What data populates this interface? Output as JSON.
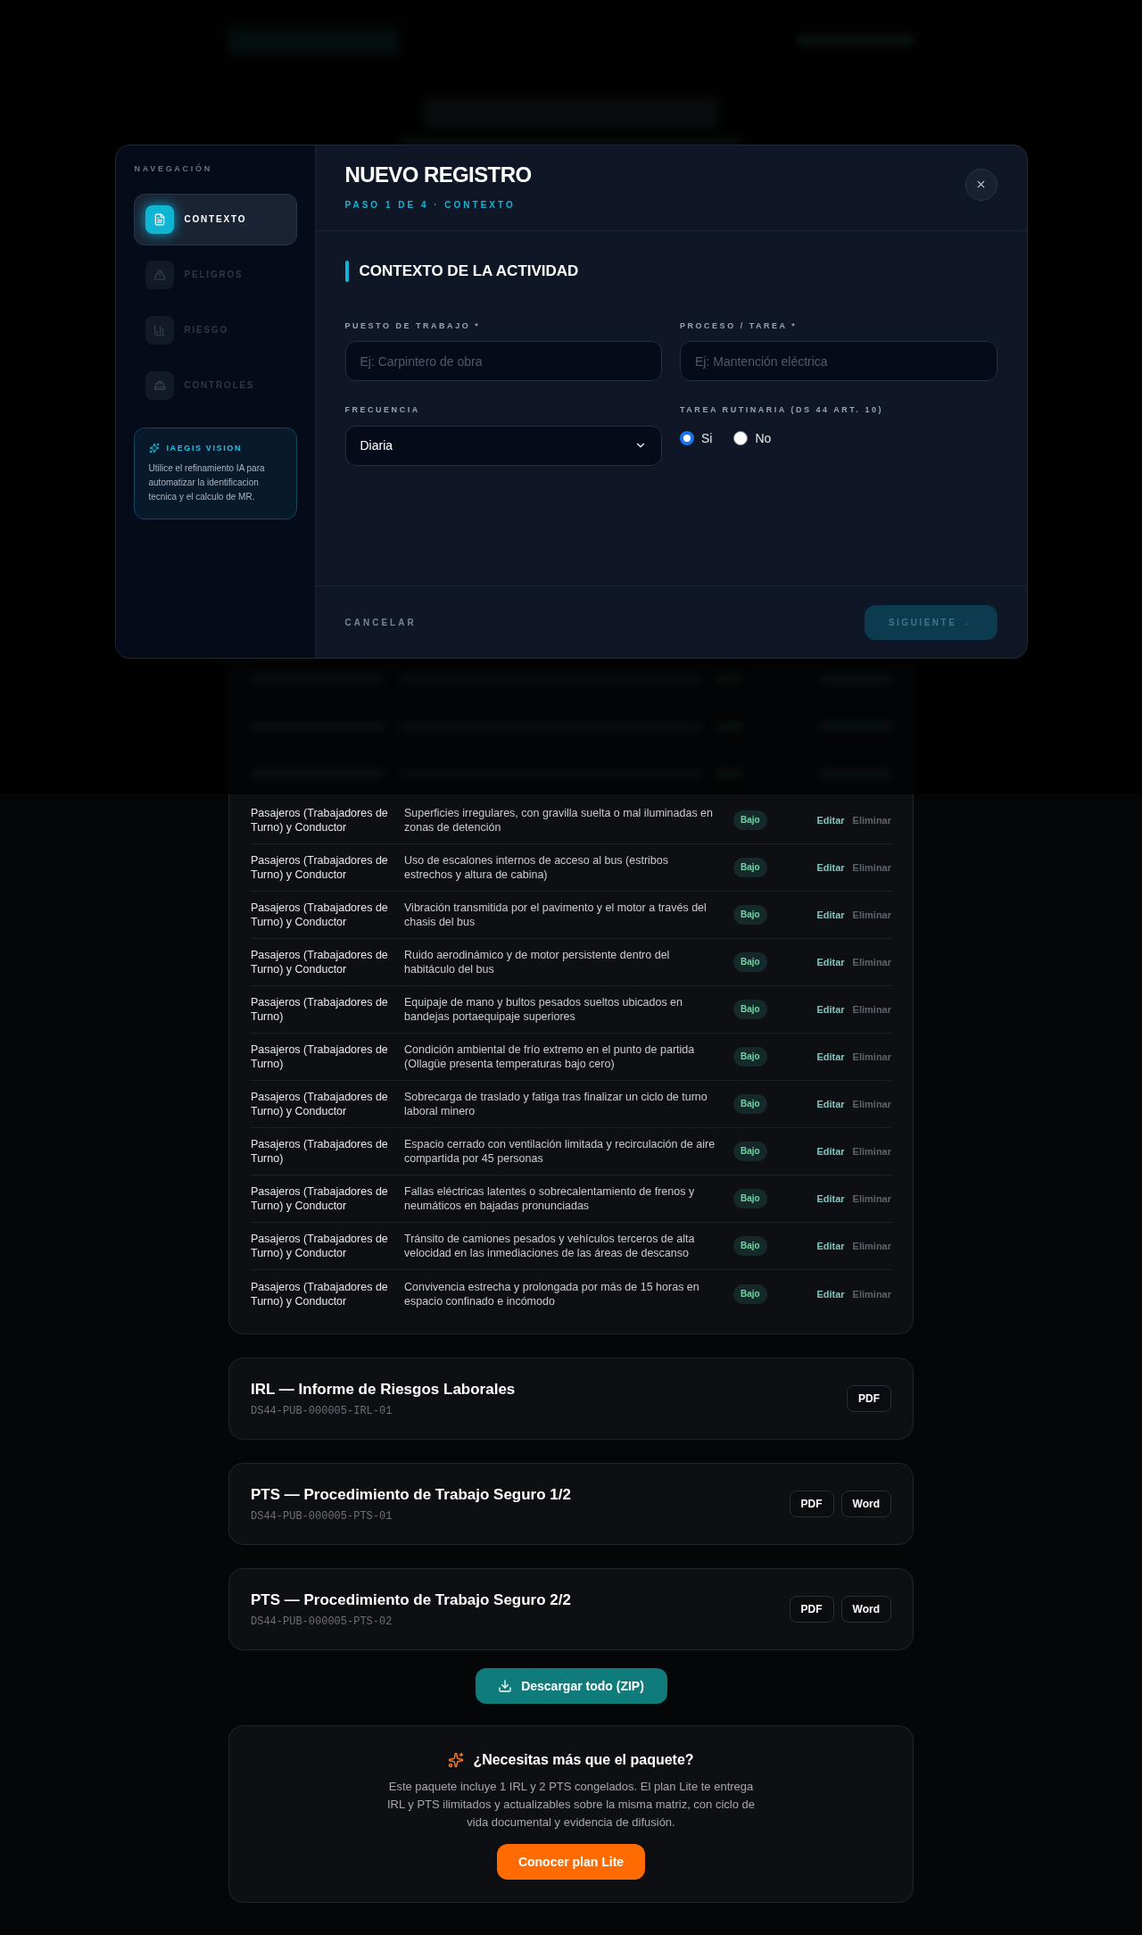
{
  "modal": {
    "nav_label": "NAVEGACIÓN",
    "steps": [
      {
        "label": "CONTEXTO",
        "selected": true
      },
      {
        "label": "PELIGROS",
        "selected": false
      },
      {
        "label": "RIESGO",
        "selected": false
      },
      {
        "label": "CONTROLES",
        "selected": false
      }
    ],
    "vision": {
      "title": "IAEGIS VISION",
      "text": "Utilice el refinamiento IA para automatizar la identificacion tecnica y el calculo de MR."
    },
    "title": "NUEVO REGISTRO",
    "step_label": "PASO 1 DE 4 · CONTEXTO",
    "section": "CONTEXTO DE LA ACTIVIDAD",
    "fields": [
      {
        "label": "PUESTO DE TRABAJO *",
        "placeholder": "Ej: Carpintero de obra"
      },
      {
        "label": "PROCESO / TAREA *",
        "placeholder": "Ej: Mantención eléctrica"
      }
    ],
    "frequency": {
      "label": "FRECUENCIA",
      "value": "Diaria"
    },
    "routine": {
      "label": "TAREA RUTINARIA (DS 44 ART. 10)",
      "options": [
        {
          "label": "Si",
          "selected": true
        },
        {
          "label": "No",
          "selected": false
        }
      ]
    },
    "cancel": "CANCELAR",
    "next": {
      "label": "SIGUIENTE →",
      "disabled": true
    }
  },
  "table": {
    "rows": [
      {
        "worker": "Pasajeros (Trabajadores de Turno) y Conductor",
        "hazard": "Superficies irregulares, con gravilla suelta o mal iluminadas en zonas de detención",
        "risk": "Bajo",
        "actions": [
          "Editar",
          "Eliminar"
        ]
      },
      {
        "worker": "Pasajeros (Trabajadores de Turno) y Conductor",
        "hazard": "Uso de escalones internos de acceso al bus (estribos estrechos y altura de cabina)",
        "risk": "Bajo",
        "actions": [
          "Editar",
          "Eliminar"
        ]
      },
      {
        "worker": "Pasajeros (Trabajadores de Turno) y Conductor",
        "hazard": "Vibración transmitida por el pavimento y el motor a través del chasis del bus",
        "risk": "Bajo",
        "actions": [
          "Editar",
          "Eliminar"
        ]
      },
      {
        "worker": "Pasajeros (Trabajadores de Turno) y Conductor",
        "hazard": "Ruido aerodinámico y de motor persistente dentro del habitáculo del bus",
        "risk": "Bajo",
        "actions": [
          "Editar",
          "Eliminar"
        ]
      },
      {
        "worker": "Pasajeros (Trabajadores de Turno)",
        "hazard": "Equipaje de mano y bultos pesados sueltos ubicados en bandejas portaequipaje superiores",
        "risk": "Bajo",
        "actions": [
          "Editar",
          "Eliminar"
        ]
      },
      {
        "worker": "Pasajeros (Trabajadores de Turno)",
        "hazard": "Condición ambiental de frío extremo en el punto de partida (Ollagüe presenta temperaturas bajo cero)",
        "risk": "Bajo",
        "actions": [
          "Editar",
          "Eliminar"
        ]
      },
      {
        "worker": "Pasajeros (Trabajadores de Turno) y Conductor",
        "hazard": "Sobrecarga de traslado y fatiga tras finalizar un ciclo de turno laboral minero",
        "risk": "Bajo",
        "actions": [
          "Editar",
          "Eliminar"
        ]
      },
      {
        "worker": "Pasajeros (Trabajadores de Turno)",
        "hazard": "Espacio cerrado con ventilación limitada y recirculación de aire compartida por 45 personas",
        "risk": "Bajo",
        "actions": [
          "Editar",
          "Eliminar"
        ]
      },
      {
        "worker": "Pasajeros (Trabajadores de Turno) y Conductor",
        "hazard": "Fallas eléctricas latentes o sobrecalentamiento de frenos y neumáticos en bajadas pronunciadas",
        "risk": "Bajo",
        "actions": [
          "Editar",
          "Eliminar"
        ]
      },
      {
        "worker": "Pasajeros (Trabajadores de Turno) y Conductor",
        "hazard": "Tránsito de camiones pesados y vehículos terceros de alta velocidad en las inmediaciones de las áreas de descanso",
        "risk": "Bajo",
        "actions": [
          "Editar",
          "Eliminar"
        ]
      },
      {
        "worker": "Pasajeros (Trabajadores de Turno) y Conductor",
        "hazard": "Convivencia estrecha y prolongada por más de 15 horas en espacio confinado e incómodo",
        "risk": "Bajo",
        "actions": [
          "Editar",
          "Eliminar"
        ]
      }
    ]
  },
  "documents": [
    {
      "title": "IRL — Informe de Riesgos Laborales",
      "code": "DS44-PUB-000005-IRL-01",
      "formats": [
        "PDF"
      ]
    },
    {
      "title": "PTS — Procedimiento de Trabajo Seguro 1/2",
      "code": "DS44-PUB-000005-PTS-01",
      "formats": [
        "PDF",
        "Word"
      ]
    },
    {
      "title": "PTS — Procedimiento de Trabajo Seguro 2/2",
      "code": "DS44-PUB-000005-PTS-02",
      "formats": [
        "PDF",
        "Word"
      ]
    }
  ],
  "download_all": "Descargar todo (ZIP)",
  "promo": {
    "title": "¿Necesitas más que el paquete?",
    "text": "Este paquete incluye 1 IRL y 2 PTS congelados. El plan Lite te entrega IRL y PTS ilimitados y actualizables sobre la misma matriz, con ciclo de vida documental y evidencia de difusión.",
    "button": "Conocer plan Lite"
  }
}
